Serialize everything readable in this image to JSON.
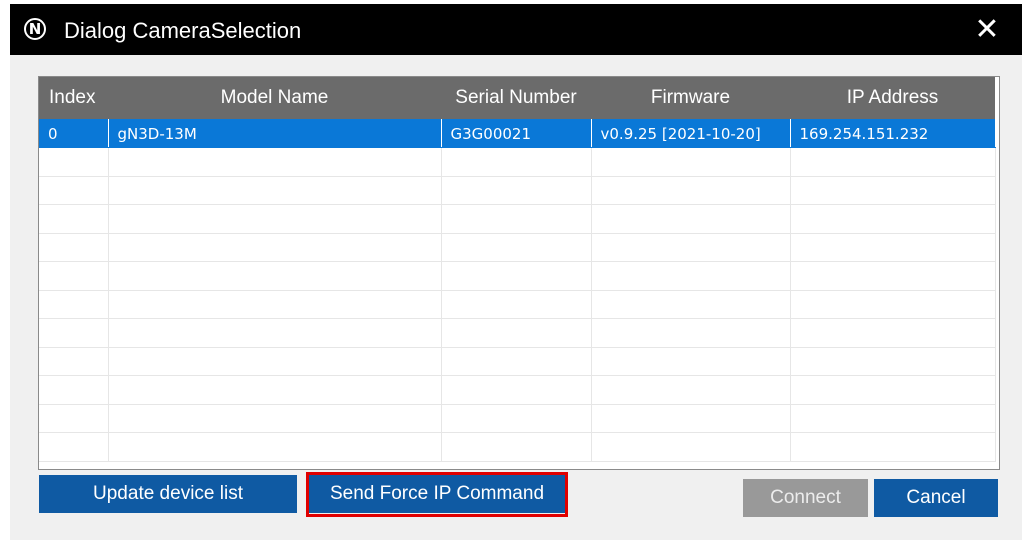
{
  "window": {
    "title": "Dialog CameraSelection",
    "app_icon_glyph": "N",
    "close_glyph": "✕"
  },
  "table": {
    "columns": [
      "Index",
      "Model Name",
      "Serial Number",
      "Firmware",
      "IP Address"
    ],
    "rows": [
      [
        "0",
        "gN3D-13M",
        "G3G00021",
        "v0.9.25 [2021-10-20]",
        "169.254.151.232"
      ]
    ],
    "selected_row": 0,
    "empty_rows": 11
  },
  "buttons": {
    "update_label": "Update device list",
    "force_ip_label": "Send Force IP Command",
    "connect_label": "Connect",
    "cancel_label": "Cancel"
  },
  "icons": {
    "app": "n-circle-icon",
    "close": "close-icon"
  },
  "colors": {
    "titlebar": "#000000",
    "header": "#6b6b6b",
    "selection": "#0a78d7",
    "button_primary": "#0f5aa3",
    "button_disabled": "#999999",
    "highlight": "#e00000"
  }
}
